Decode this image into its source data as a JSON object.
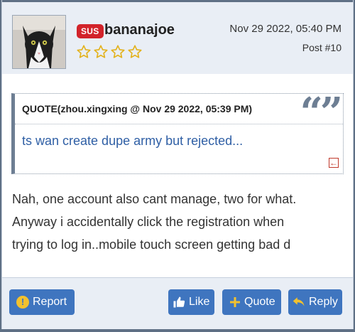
{
  "post": {
    "badge": "SUS",
    "username": "bananajoe",
    "rating_stars": 4,
    "rating_filled": 0,
    "date": "Nov 29 2022, 05:40 PM",
    "post_number": "Post #10"
  },
  "quote": {
    "title": "QUOTE(zhou.xingxing @ Nov 29 2022, 05:39 PM)",
    "text": "ts wan create dupe army but rejected...",
    "marks": "“”"
  },
  "message": {
    "lines": [
      "Nah, one account also cant manage, two for what.",
      "Anyway i accidentally click the registration when",
      "trying to log in..mobile touch screen getting bad d"
    ]
  },
  "footer": {
    "report_label": "Report",
    "like_label": "Like",
    "quote_label": "Quote",
    "reply_label": "Reply"
  },
  "colors": {
    "accent": "#3f75bf",
    "badge": "#d2232a",
    "star": "#e3b21c",
    "quote_text": "#2f5fa5"
  },
  "icons": {
    "report": "exclamation-circle-icon",
    "like": "thumbs-up-icon",
    "quote": "plus-icon",
    "reply": "reply-arrow-icon",
    "quote_link": "quote-link-arrow-icon"
  }
}
